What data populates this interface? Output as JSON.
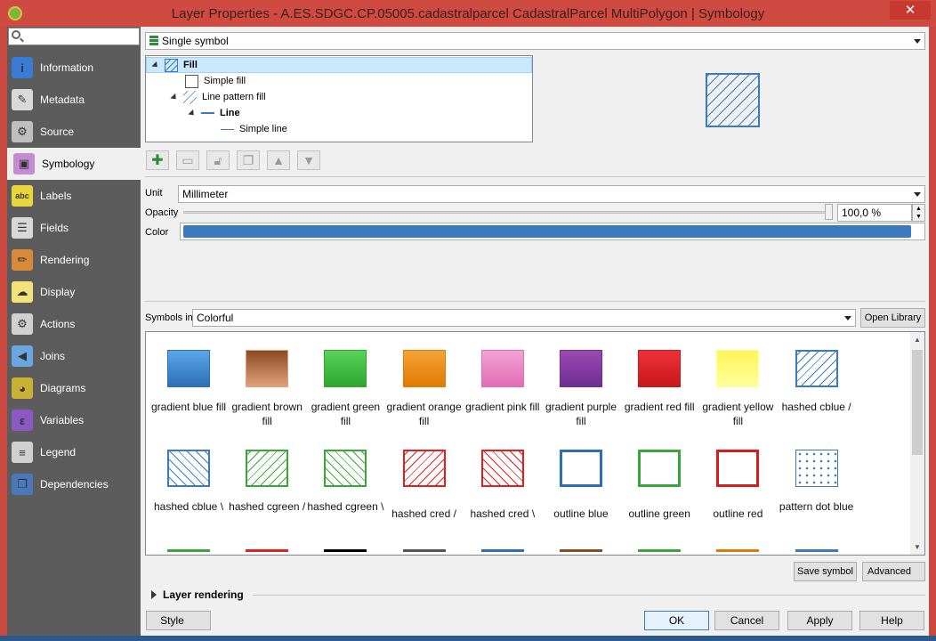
{
  "window": {
    "title": "Layer Properties - A.ES.SDGC.CP.05005.cadastralparcel CadastralParcel MultiPolygon | Symbology",
    "close_glyph": "✕"
  },
  "sidebar": {
    "search_placeholder": "",
    "items": [
      {
        "label": "Information",
        "icon": "info-icon",
        "color": "#3a7bd5",
        "glyph": "i"
      },
      {
        "label": "Metadata",
        "icon": "metadata-icon",
        "color": "#d9d9d9",
        "glyph": "✎"
      },
      {
        "label": "Source",
        "icon": "source-icon",
        "color": "#bfbfbf",
        "glyph": "⚙"
      },
      {
        "label": "Symbology",
        "icon": "symbology-icon",
        "color": "#c48bd0",
        "glyph": "▣"
      },
      {
        "label": "Labels",
        "icon": "labels-icon",
        "color": "#e8d53a",
        "glyph": "abc"
      },
      {
        "label": "Fields",
        "icon": "fields-icon",
        "color": "#d8d8d8",
        "glyph": "☰"
      },
      {
        "label": "Rendering",
        "icon": "rendering-icon",
        "color": "#d8893a",
        "glyph": "✏"
      },
      {
        "label": "Display",
        "icon": "display-icon",
        "color": "#f2e27a",
        "glyph": "☁"
      },
      {
        "label": "Actions",
        "icon": "actions-icon",
        "color": "#d0d0d0",
        "glyph": "⚙"
      },
      {
        "label": "Joins",
        "icon": "joins-icon",
        "color": "#6aa6e0",
        "glyph": "◀"
      },
      {
        "label": "Diagrams",
        "icon": "diagrams-icon",
        "color": "#c9b133",
        "glyph": "◕"
      },
      {
        "label": "Variables",
        "icon": "variables-icon",
        "color": "#8a5ac2",
        "glyph": "ε"
      },
      {
        "label": "Legend",
        "icon": "legend-icon",
        "color": "#d0d0d0",
        "glyph": "≡"
      },
      {
        "label": "Dependencies",
        "icon": "dependencies-icon",
        "color": "#4b78b8",
        "glyph": "❐"
      }
    ],
    "active_index": 3
  },
  "renderer": {
    "value": "Single symbol"
  },
  "tree": {
    "rows": [
      {
        "label": "Fill"
      },
      {
        "label": "Simple fill"
      },
      {
        "label": "Line pattern fill"
      },
      {
        "label": "Line"
      },
      {
        "label": "Simple line"
      }
    ]
  },
  "props": {
    "unit_label": "Unit",
    "unit_value": "Millimeter",
    "opacity_label": "Opacity",
    "opacity_value": "100,0 %",
    "color_label": "Color",
    "color_value": "#3a7bbf"
  },
  "library": {
    "symbols_in_label": "Symbols in",
    "symbols_in_value": "Colorful",
    "open_library": "Open Library"
  },
  "symbols": [
    {
      "name": "gradient blue fill",
      "kind": "grad",
      "c1": "#5aa7e8",
      "c2": "#2d6fb7"
    },
    {
      "name": "gradient brown fill",
      "kind": "grad",
      "c1": "#8a4a24",
      "c2": "#e0a07a"
    },
    {
      "name": "gradient green fill",
      "kind": "grad",
      "c1": "#5ad35a",
      "c2": "#2fa52f"
    },
    {
      "name": "gradient orange fill",
      "kind": "grad",
      "c1": "#f5a33a",
      "c2": "#e07a00"
    },
    {
      "name": "gradient pink fill",
      "kind": "grad",
      "c1": "#f2a3d5",
      "c2": "#e36cb7"
    },
    {
      "name": "gradient purple fill",
      "kind": "grad",
      "c1": "#9a4ab0",
      "c2": "#6e2d96"
    },
    {
      "name": "gradient red fill",
      "kind": "grad",
      "c1": "#f0303a",
      "c2": "#c81818"
    },
    {
      "name": "gradient yellow fill",
      "kind": "grad",
      "c1": "#fff55a",
      "c2": "#ffff9a"
    },
    {
      "name": "hashed cblue /",
      "kind": "hash",
      "c1": "#3a7bbf",
      "dir": "-45deg"
    },
    {
      "name": "hashed cblue \\",
      "kind": "hash",
      "c1": "#3a7bbf",
      "dir": "45deg"
    },
    {
      "name": "hashed cgreen /",
      "kind": "hash",
      "c1": "#3aa63a",
      "dir": "-45deg"
    },
    {
      "name": "hashed cgreen \\",
      "kind": "hash",
      "c1": "#3aa63a",
      "dir": "45deg"
    },
    {
      "name": "hashed cred /",
      "kind": "hash",
      "c1": "#e02020",
      "dir": "-45deg"
    },
    {
      "name": "hashed cred \\",
      "kind": "hash",
      "c1": "#e02020",
      "dir": "45deg"
    },
    {
      "name": "outline blue",
      "kind": "outline",
      "c1": "#2d6fb7"
    },
    {
      "name": "outline green",
      "kind": "outline",
      "c1": "#3aa63a"
    },
    {
      "name": "outline red",
      "kind": "outline",
      "c1": "#d81c1c"
    },
    {
      "name": "pattern dot blue",
      "kind": "dots",
      "c1": "#3a7bbf"
    }
  ],
  "partial_symbol_colors": [
    "#3aa63a",
    "#e02020",
    "#000000",
    "#555555",
    "#2d6fb7",
    "#8a4a24",
    "#3aa63a",
    "#e07a00",
    "#3a7bbf",
    "#e36cb7"
  ],
  "footer": {
    "save_symbol": "Save symbol",
    "advanced": "Advanced",
    "layer_rendering": "Layer rendering",
    "style": "Style",
    "ok": "OK",
    "cancel": "Cancel",
    "apply": "Apply",
    "help": "Help"
  }
}
